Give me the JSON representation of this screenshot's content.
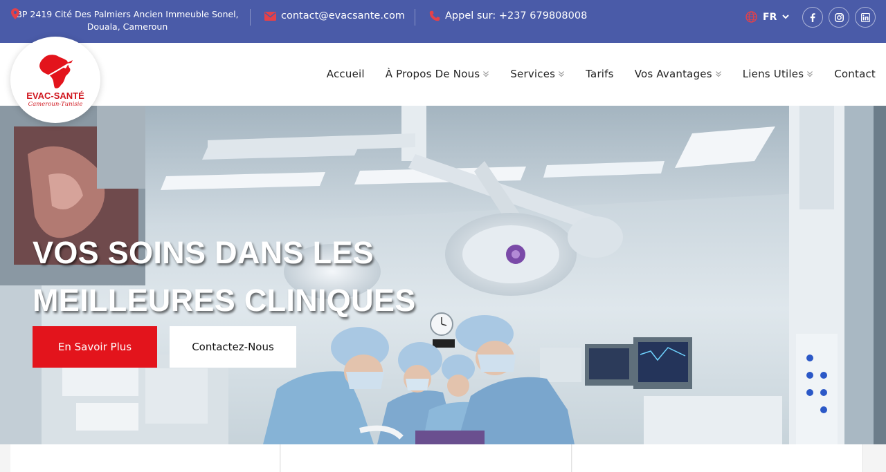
{
  "topbar": {
    "address_line1": "BP 2419 Cité Des Palmiers Ancien Immeuble Sonel,",
    "address_line2": "Douala, Cameroun",
    "email": "contact@evacsante.com",
    "phone": "Appel sur: +237 679808008",
    "language": "FR",
    "social": [
      "facebook-icon",
      "instagram-icon",
      "linkedin-icon"
    ],
    "colors": {
      "bar": "#4a5ba8",
      "accent_red": "#e3414a"
    }
  },
  "logo": {
    "brand": "EVAC-SANTÉ",
    "tagline": "Cameroun-Tunisie"
  },
  "nav": {
    "items": [
      {
        "label": "Accueil",
        "dropdown": false
      },
      {
        "label": "À Propos De Nous",
        "dropdown": true
      },
      {
        "label": "Services",
        "dropdown": true
      },
      {
        "label": "Tarifs",
        "dropdown": false
      },
      {
        "label": "Vos Avantages",
        "dropdown": true
      },
      {
        "label": "Liens Utiles",
        "dropdown": true
      },
      {
        "label": "Contact",
        "dropdown": false
      }
    ]
  },
  "hero": {
    "title_line1": "VOS SOINS DANS LES",
    "title_line2": "MEILLEURES CLINIQUES",
    "primary_button": "En Savoir Plus",
    "secondary_button": "Contactez-Nous",
    "colors": {
      "primary": "#e3141c"
    }
  }
}
